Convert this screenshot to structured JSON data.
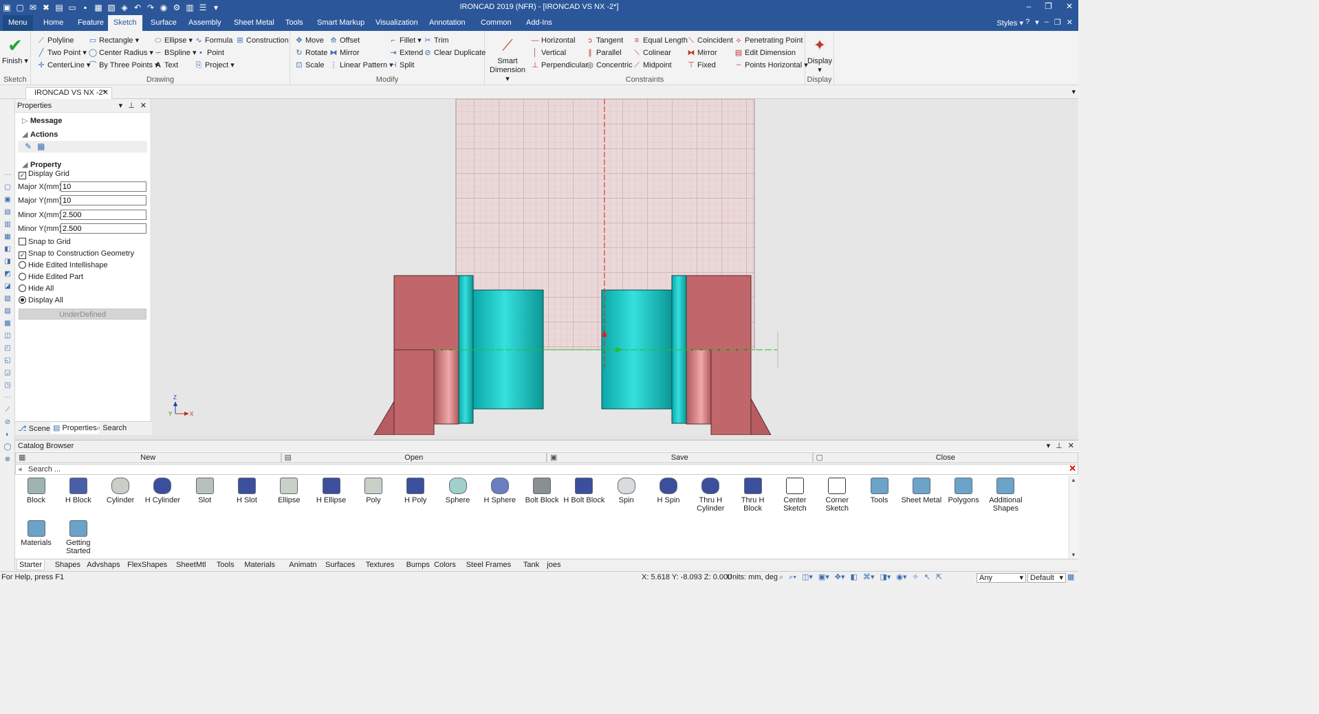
{
  "window": {
    "title": "IRONCAD 2019 (NFR) - [IRONCAD VS NX -2*]"
  },
  "ribbon_tabs": [
    "Menu",
    "Home",
    "Feature",
    "Sketch",
    "Surface",
    "Assembly",
    "Sheet Metal",
    "Tools",
    "Smart Markup",
    "Visualization",
    "Annotation",
    "Common",
    "Add-Ins"
  ],
  "active_tab": "Sketch",
  "styles_label": "Styles",
  "ribbon": {
    "sketch": {
      "label": "Sketch",
      "finish": "Finish"
    },
    "drawing": {
      "label": "Drawing",
      "items": [
        "Polyline",
        "Rectangle",
        "Ellipse",
        "Formula",
        "Construction",
        "Two Point",
        "Center Radius",
        "BSpline",
        "Point",
        "CenterLine",
        "By Three Points",
        "Text",
        "Project"
      ]
    },
    "modify": {
      "label": "Modify",
      "items": [
        "Move",
        "Offset",
        "Fillet",
        "Trim",
        "Rotate",
        "Mirror",
        "Extend",
        "Clear Duplicate",
        "Scale",
        "Linear Pattern",
        "Split"
      ]
    },
    "constraints": {
      "label": "Constraints",
      "smart_dimension": "Smart Dimension",
      "items": [
        "Horizontal",
        "Tangent",
        "Equal Length",
        "Coincident",
        "Penetrating Point",
        "Vertical",
        "Parallel",
        "Colinear",
        "Mirror",
        "Edit Dimension",
        "Perpendicular",
        "Concentric",
        "Midpoint",
        "Fixed",
        "Points Horizontal"
      ]
    },
    "display": {
      "label": "Display",
      "button": "Display"
    }
  },
  "document_tab": "IRONCAD VS NX -2*",
  "properties": {
    "title": "Properties",
    "message": "Message",
    "actions": "Actions",
    "property": "Property",
    "display_grid": "Display Grid",
    "fields": [
      {
        "label": "Major X(mm)",
        "value": "10"
      },
      {
        "label": "Major Y(mm)",
        "value": "10"
      },
      {
        "label": "Minor X(mm)",
        "value": "2.500"
      },
      {
        "label": "Minor Y(mm)",
        "value": "2.500"
      }
    ],
    "snap_to_grid": "Snap to Grid",
    "snap_to_construction": "Snap to Construction Geometry",
    "hide_edited_intellishape": "Hide Edited Intellishape",
    "hide_edited_part": "Hide Edited Part",
    "hide_all": "Hide All",
    "display_all": "Display All",
    "underdefined": "UnderDefined",
    "bottom_tabs": [
      "Scene",
      "Properties",
      "Search"
    ]
  },
  "viewport": {
    "triad": {
      "z": "Z",
      "y": "Y",
      "x": "X"
    }
  },
  "catalog": {
    "title": "Catalog Browser",
    "buttons": [
      "New",
      "Open",
      "Save",
      "Close"
    ],
    "search_placeholder": "Search ...",
    "items": [
      "Block",
      "H Block",
      "Cylinder",
      "H Cylinder",
      "Slot",
      "H Slot",
      "Ellipse",
      "H Ellipse",
      "Poly",
      "H Poly",
      "Sphere",
      "H Sphere",
      "Bolt Block",
      "H Bolt Block",
      "Spin",
      "H Spin",
      "Thru H Cylinder",
      "Thru H Block",
      "Center Sketch",
      "Corner Sketch",
      "Tools",
      "Sheet Metal",
      "Polygons",
      "Additional Shapes",
      "Materials",
      "Getting Started"
    ],
    "tabs": [
      "Starter",
      "Shapes",
      "Advshaps",
      "FlexShapes",
      "SheetMtl",
      "Tools",
      "Materials",
      "Animatn",
      "Surfaces",
      "Textures",
      "Bumps",
      "Colors",
      "Steel Frames",
      "Tank",
      "joes"
    ]
  },
  "status": {
    "help": "For Help, press F1",
    "coords": "X: 5.618 Y: -8.093 Z: 0.000",
    "units": "Units: mm, deg",
    "filter": "Any",
    "mode": "Default"
  }
}
